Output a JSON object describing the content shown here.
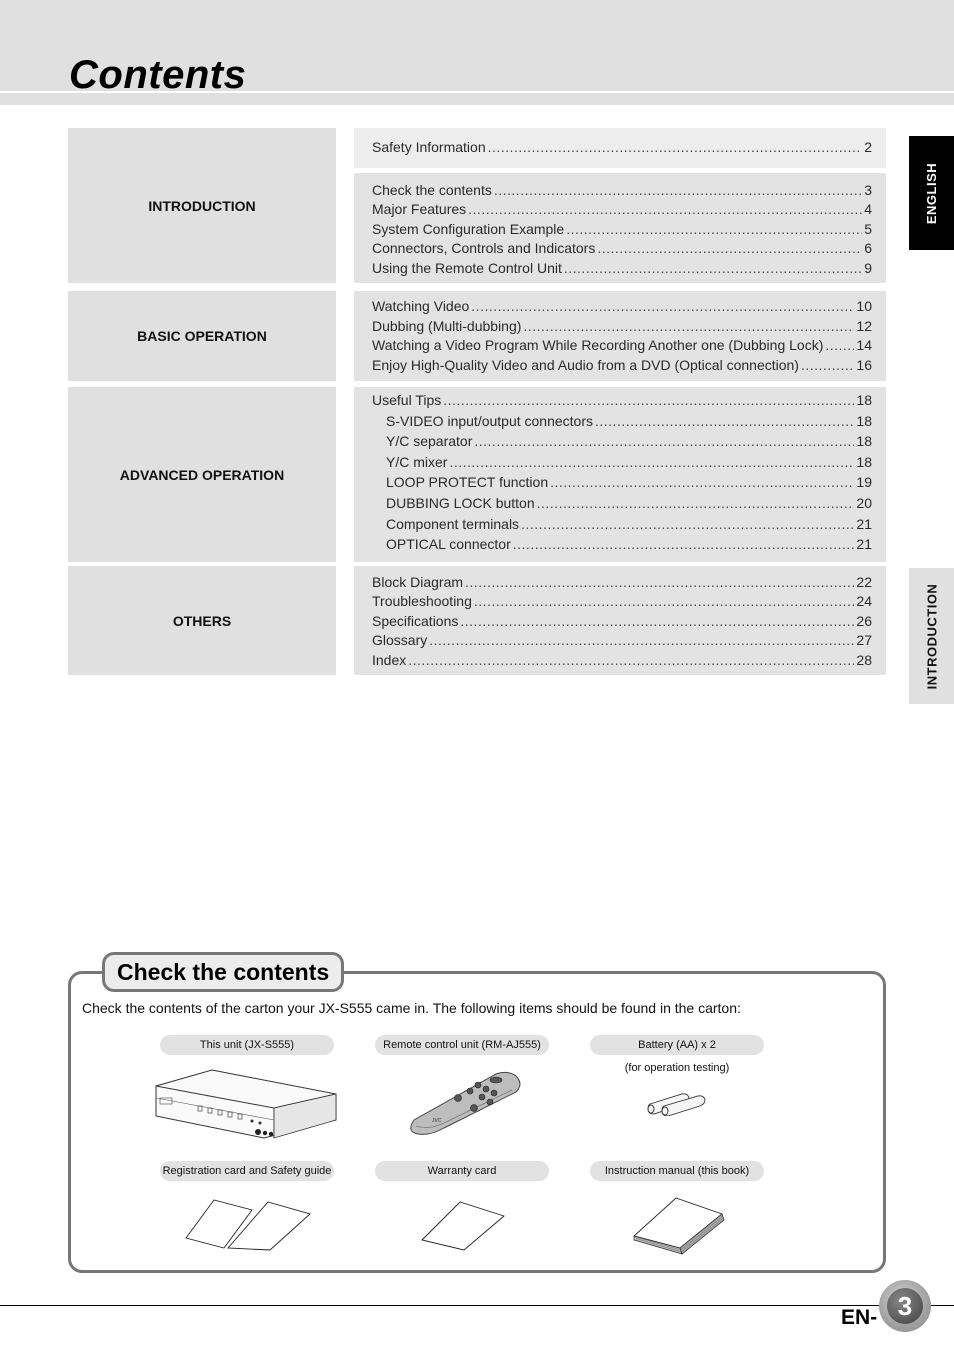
{
  "header": {
    "title": "Contents"
  },
  "side_tabs": {
    "language": "ENGLISH",
    "section": "INTRODUCTION"
  },
  "toc": {
    "sections": [
      {
        "label": "INTRODUCTION",
        "groups": [
          [
            {
              "title": "Safety Information",
              "page": "2"
            }
          ],
          [
            {
              "title": "Check the contents",
              "page": "3"
            },
            {
              "title": "Major Features",
              "page": "4"
            },
            {
              "title": "System Configuration Example",
              "page": "5"
            },
            {
              "title": "Connectors, Controls and Indicators",
              "page": "6"
            },
            {
              "title": "Using the Remote Control Unit",
              "page": "9"
            }
          ]
        ]
      },
      {
        "label": "BASIC OPERATION",
        "groups": [
          [
            {
              "title": "Watching Video",
              "page": "10"
            },
            {
              "title": "Dubbing (Multi-dubbing)",
              "page": "12"
            },
            {
              "title": "Watching a Video Program While Recording Another one (Dubbing Lock)",
              "page": "14"
            },
            {
              "title": "Enjoy High-Quality Video and Audio from a DVD (Optical connection)",
              "page": "16"
            }
          ]
        ]
      },
      {
        "label": "ADVANCED OPERATION",
        "groups": [
          [
            {
              "title": "Useful Tips",
              "page": "18"
            },
            {
              "title": "S-VIDEO input/output connectors",
              "page": "18",
              "sub": true
            },
            {
              "title": "Y/C separator",
              "page": "18",
              "sub": true
            },
            {
              "title": "Y/C mixer",
              "page": "18",
              "sub": true
            },
            {
              "title": "LOOP PROTECT function",
              "page": "19",
              "sub": true
            },
            {
              "title": "DUBBING LOCK button",
              "page": "20",
              "sub": true
            },
            {
              "title": "Component terminals",
              "page": "21",
              "sub": true
            },
            {
              "title": "OPTICAL connector",
              "page": "21",
              "sub": true
            }
          ]
        ]
      },
      {
        "label": "OTHERS",
        "groups": [
          [
            {
              "title": "Block Diagram",
              "page": "22"
            },
            {
              "title": "Troubleshooting",
              "page": "24"
            },
            {
              "title": "Specifications",
              "page": "26"
            },
            {
              "title": "Glossary",
              "page": "27"
            },
            {
              "title": "Index",
              "page": "28"
            }
          ]
        ]
      }
    ]
  },
  "check_contents": {
    "title": "Check the contents",
    "intro": "Check the contents of the carton your JX-S555 came in. The following items should be found in the carton:",
    "items": [
      {
        "label": "This unit (JX-S555)",
        "icon": "av-unit-icon"
      },
      {
        "label": "Remote control unit (RM-AJ555)",
        "icon": "remote-control-icon"
      },
      {
        "label": "Battery (AA) x 2",
        "note": "(for operation testing)",
        "icon": "battery-icon"
      },
      {
        "label": "Registration card and Safety guide",
        "icon": "cards-icon"
      },
      {
        "label": "Warranty card",
        "icon": "card-icon"
      },
      {
        "label": "Instruction manual (this book)",
        "icon": "manual-book-icon"
      }
    ]
  },
  "footer": {
    "prefix": "EN-",
    "page_number": "3"
  }
}
